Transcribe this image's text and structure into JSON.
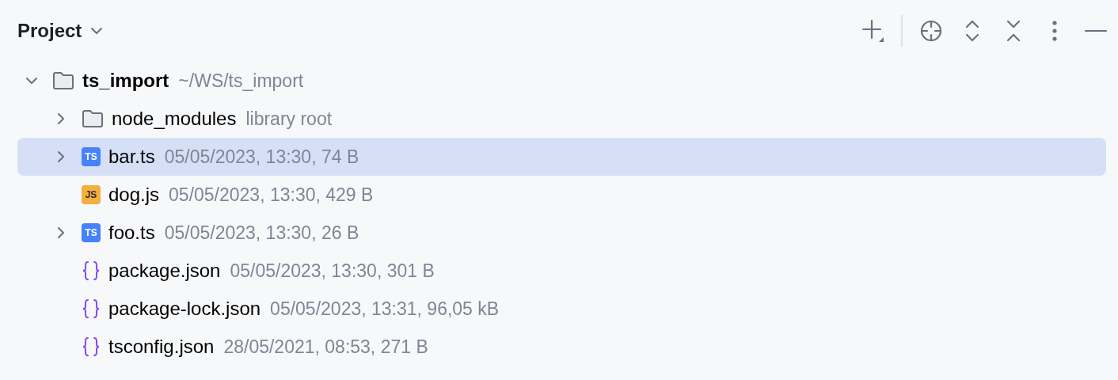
{
  "panel": {
    "title": "Project"
  },
  "tree": [
    {
      "kind": "folder",
      "name": "ts_import",
      "detail": "~/WS/ts_import",
      "expanded": true,
      "selected": false,
      "children": [
        {
          "kind": "folder",
          "name": "node_modules",
          "detail": "library root",
          "expanded": false,
          "selected": false
        },
        {
          "kind": "ts",
          "icon_label": "TS",
          "name": "bar.ts",
          "detail": "05/05/2023, 13:30, 74 B",
          "expanded": false,
          "selected": true
        },
        {
          "kind": "js",
          "icon_label": "JS",
          "name": "dog.js",
          "detail": "05/05/2023, 13:30, 429 B",
          "selected": false
        },
        {
          "kind": "ts",
          "icon_label": "TS",
          "name": "foo.ts",
          "detail": "05/05/2023, 13:30, 26 B",
          "expanded": false,
          "selected": false
        },
        {
          "kind": "json",
          "name": "package.json",
          "detail": "05/05/2023, 13:30, 301 B",
          "selected": false
        },
        {
          "kind": "json",
          "name": "package-lock.json",
          "detail": "05/05/2023, 13:31, 96,05 kB",
          "selected": false
        },
        {
          "kind": "json",
          "name": "tsconfig.json",
          "detail": "28/05/2021, 08:53, 271 B",
          "selected": false
        }
      ]
    }
  ]
}
